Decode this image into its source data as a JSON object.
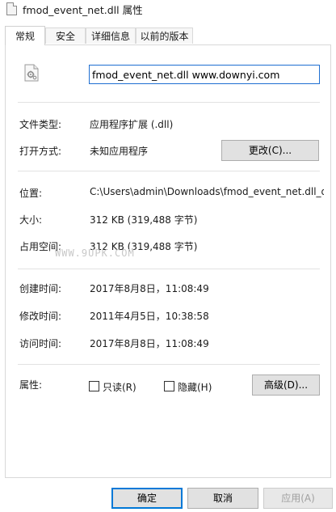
{
  "window": {
    "title": "fmod_event_net.dll 属性"
  },
  "tabs": [
    {
      "label": "常规",
      "active": true
    },
    {
      "label": "安全",
      "active": false
    },
    {
      "label": "详细信息",
      "active": false
    },
    {
      "label": "以前的版本",
      "active": false
    }
  ],
  "file": {
    "icon": "dll-file-gear-icon",
    "name_value": "fmod_event_net.dll www.downyi.com"
  },
  "type_section": {
    "file_type_label": "文件类型:",
    "file_type_value": "应用程序扩展 (.dll)",
    "open_with_label": "打开方式:",
    "open_with_value": "未知应用程序",
    "change_button": "更改(C)..."
  },
  "location_section": {
    "location_label": "位置:",
    "location_value": "C:\\Users\\admin\\Downloads\\fmod_event_net.dll_d",
    "size_label": "大小:",
    "size_value": "312 KB (319,488 字节)",
    "size_on_disk_label": "占用空间:",
    "size_on_disk_value": "312 KB (319,488 字节)"
  },
  "watermark": "WWW.9UPK.COM",
  "time_section": {
    "created_label": "创建时间:",
    "created_value": "2017年8月8日，11:08:49",
    "modified_label": "修改时间:",
    "modified_value": "2011年4月5日，10:38:58",
    "accessed_label": "访问时间:",
    "accessed_value": "2017年8月8日，11:08:49"
  },
  "attributes": {
    "label": "属性:",
    "readonly_label": "只读(R)",
    "readonly_checked": false,
    "hidden_label": "隐藏(H)",
    "hidden_checked": false,
    "advanced_button": "高级(D)..."
  },
  "footer": {
    "ok_button": "确定",
    "cancel_button": "取消",
    "apply_button": "应用(A)"
  },
  "colors": {
    "focus_blue": "#0078d7",
    "input_border": "#1f6fd1"
  }
}
